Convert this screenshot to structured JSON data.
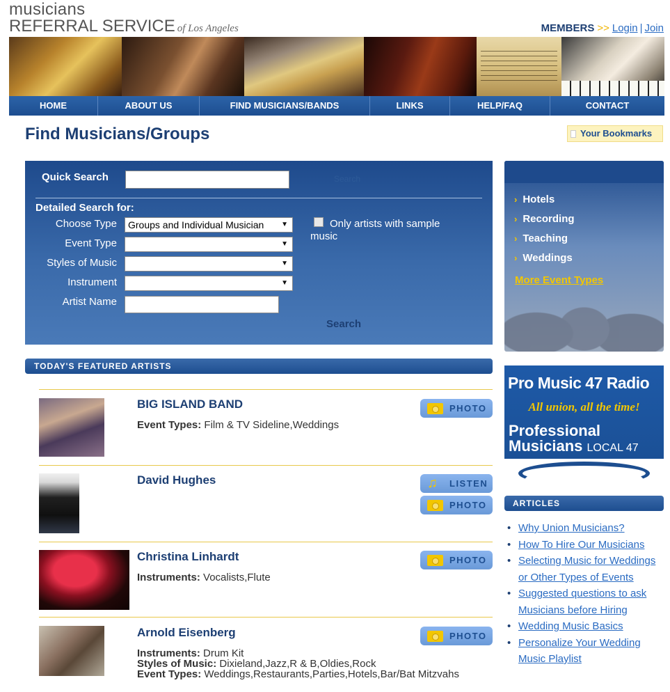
{
  "header": {
    "logo_top": "musicians",
    "logo_bottom": "REFERRAL SERVICE",
    "logo_sub": "of Los Angeles",
    "members_label": "MEMBERS",
    "members_arrows": ">>",
    "login": "Login",
    "separator": "|",
    "join": "Join"
  },
  "nav": [
    "HOME",
    "ABOUT US",
    "FIND MUSICIANS/BANDS",
    "LINKS",
    "HELP/FAQ",
    "CONTACT"
  ],
  "page": {
    "title": "Find Musicians/Groups",
    "bookmarks": "Your Bookmarks"
  },
  "search": {
    "quick_label": "Quick Search",
    "quick_go": "Search",
    "detailed_label": "Detailed Search for:",
    "choose_type_label": "Choose Type",
    "choose_type_value": "Groups and Individual Musician",
    "event_type_label": "Event Type",
    "event_type_value": "",
    "styles_label": "Styles of Music",
    "styles_value": "",
    "instrument_label": "Instrument",
    "instrument_value": "",
    "artist_name_label": "Artist Name",
    "only_sample_label": "Only artists with sample music",
    "search_button": "Search"
  },
  "featured": {
    "header": "TODAY'S FEATURED ARTISTS",
    "photo_label": "PHOTO",
    "listen_label": "LISTEN",
    "artists": [
      {
        "name": "BIG ISLAND BAND",
        "line1_label": "Event Types:",
        "line1_value": "Film & TV Sideline,Weddings"
      },
      {
        "name": "David Hughes"
      },
      {
        "name": "Christina Linhardt",
        "line1_label": "Instruments:",
        "line1_value": "Vocalists,Flute"
      },
      {
        "name": "Arnold Eisenberg",
        "line1_label": "Instruments:",
        "line1_value": "Drum Kit",
        "line2_label": "Styles of Music:",
        "line2_value": "Dixieland,Jazz,R & B,Oldies,Rock",
        "line3_label": "Event Types:",
        "line3_value": "Weddings,Restaurants,Parties,Hotels,Bar/Bat Mitzvahs"
      }
    ]
  },
  "sidebar": {
    "events": [
      "Hotels",
      "Recording",
      "Teaching",
      "Weddings"
    ],
    "more_events": "More Event Types",
    "ad": {
      "line1": "Pro Music 47 Radio",
      "line2": "All union, all the time!",
      "line3a": "Professional",
      "line3b": "Musicians",
      "line3c": "LOCAL 47"
    },
    "articles_header": "ARTICLES",
    "articles": [
      "Why Union Musicians?",
      "How To Hire Our Musicians",
      "Selecting Music for Weddings or Other Types of Events",
      "Suggested questions to ask Musicians before Hiring",
      "Wedding Music Basics",
      "Personalize Your Wedding Music Playlist"
    ]
  },
  "icons": {
    "chevron": "chevron-right-icon",
    "camera": "camera-icon",
    "note": "music-note-icon"
  },
  "colors": {
    "brand_blue": "#1d3f73",
    "nav_blue": "#1d4e90",
    "accent_yellow": "#f2c600",
    "link_blue": "#2a6bc2"
  }
}
